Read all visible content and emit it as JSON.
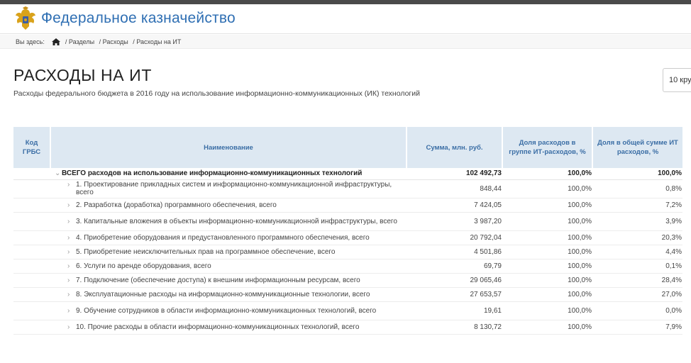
{
  "header": {
    "site_title": "Федеральное казначейство"
  },
  "breadcrumb": {
    "prefix": "Вы здесь:",
    "items": [
      "/ Разделы",
      "/ Расходы",
      "/ Расходы на ИТ"
    ]
  },
  "page": {
    "title": "РАСХОДЫ НА ИТ",
    "subtitle": "Расходы федерального бюджета в 2016 году на использование информационно-коммуникационных (ИК) технологий",
    "selector_value": "10 кру"
  },
  "table": {
    "headers": {
      "code": "Код ГРБС",
      "name": "Наименование",
      "sum": "Сумма, млн. руб.",
      "share_group": "Доля расходов в группе ИТ-расходов, %",
      "share_total": "Доля в общей сумме ИТ расходов, %"
    },
    "total": {
      "code": "",
      "name": "ВСЕГО расходов на использование информационно-коммуникационных технологий",
      "sum": "102 492,73",
      "share_group": "100,0%",
      "share_total": "100,0%"
    },
    "rows": [
      {
        "code": "",
        "name": "1. Проектирование прикладных систем и информационно-коммуникационной инфраструктуры, всего",
        "sum": "848,44",
        "share_group": "100,0%",
        "share_total": "0,8%"
      },
      {
        "code": "",
        "name": "2. Разработка (доработка) программного обеспечения, всего",
        "sum": "7 424,05",
        "share_group": "100,0%",
        "share_total": "7,2%"
      },
      {
        "code": "",
        "name": "3. Капитальные вложения в объекты информационно-коммуникационной инфраструктуры, всего",
        "sum": "3 987,20",
        "share_group": "100,0%",
        "share_total": "3,9%"
      },
      {
        "code": "",
        "name": "4. Приобретение оборудования и предустановленного программного обеспечения, всего",
        "sum": "20 792,04",
        "share_group": "100,0%",
        "share_total": "20,3%"
      },
      {
        "code": "",
        "name": "5. Приобретение неисключительных прав на программное обеспечение, всего",
        "sum": "4 501,86",
        "share_group": "100,0%",
        "share_total": "4,4%"
      },
      {
        "code": "",
        "name": "6. Услуги по аренде оборудования, всего",
        "sum": "69,79",
        "share_group": "100,0%",
        "share_total": "0,1%"
      },
      {
        "code": "",
        "name": "7. Подключение (обеспечение доступа) к внешним информационным ресурсам, всего",
        "sum": "29 065,46",
        "share_group": "100,0%",
        "share_total": "28,4%"
      },
      {
        "code": "",
        "name": "8. Эксплуатационные расходы на информационно-коммуникационные технологии, всего",
        "sum": "27 653,57",
        "share_group": "100,0%",
        "share_total": "27,0%"
      },
      {
        "code": "",
        "name": "9. Обучение сотрудников в области информационно-коммуникационных технологий, всего",
        "sum": "19,61",
        "share_group": "100,0%",
        "share_total": "0,0%"
      },
      {
        "code": "",
        "name": "10. Прочие расходы в области информационно-коммуникационных технологий, всего",
        "sum": "8 130,72",
        "share_group": "100,0%",
        "share_total": "7,9%"
      }
    ]
  },
  "icons": {
    "emblem": "double-headed-eagle-emblem",
    "home": "home-icon",
    "collapse": "chevron-down-icon",
    "expand": "chevron-right-icon"
  },
  "colors": {
    "brand": "#2f6fb3",
    "header_bg": "#dde8f2",
    "emblem_gold": "#d9a21b"
  }
}
